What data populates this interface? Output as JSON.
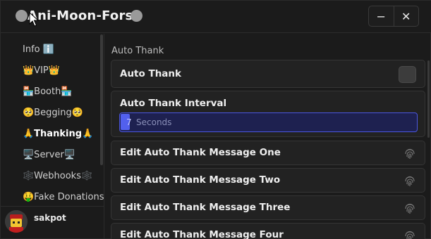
{
  "window": {
    "title": "Ani-Moon-Fors",
    "minimize_icon": "−",
    "close_icon": "✕"
  },
  "sidebar": {
    "items": [
      {
        "label": "Info ℹ️",
        "icon": "info-icon",
        "active": false
      },
      {
        "label": "👑VIP👑",
        "icon": "crown-icon",
        "active": false
      },
      {
        "label": "🏪Booth🏪",
        "icon": "booth-icon",
        "active": false
      },
      {
        "label": "🥺Begging🥺",
        "icon": "pleading-face-icon",
        "active": false
      },
      {
        "label": "🙏Thanking🙏",
        "icon": "praying-hands-icon",
        "active": true
      },
      {
        "label": "🖥️Server🖥️",
        "icon": "computer-icon",
        "active": false
      },
      {
        "label": "🕸️Webhooks🕸️",
        "icon": "web-icon",
        "active": false
      },
      {
        "label": "🤑Fake Donations",
        "icon": "money-face-icon",
        "active": false
      }
    ]
  },
  "user": {
    "name": "sakpot"
  },
  "content": {
    "section_title": "Auto Thank",
    "auto_thank": {
      "label": "Auto Thank",
      "enabled": false
    },
    "interval": {
      "label": "Auto Thank Interval",
      "value": "7",
      "placeholder": "Seconds"
    },
    "messages": [
      {
        "label": "Edit Auto Thank Message One",
        "icon": "fingerprint-icon"
      },
      {
        "label": "Edit Auto Thank Message Two",
        "icon": "fingerprint-icon"
      },
      {
        "label": "Edit Auto Thank Message Three",
        "icon": "fingerprint-icon"
      },
      {
        "label": "Edit Auto Thank Message Four",
        "icon": "fingerprint-icon"
      }
    ]
  },
  "colors": {
    "background": "#1b1b1b",
    "card": "#222222",
    "accent": "#5260ee",
    "input_bg": "#1e2150"
  }
}
